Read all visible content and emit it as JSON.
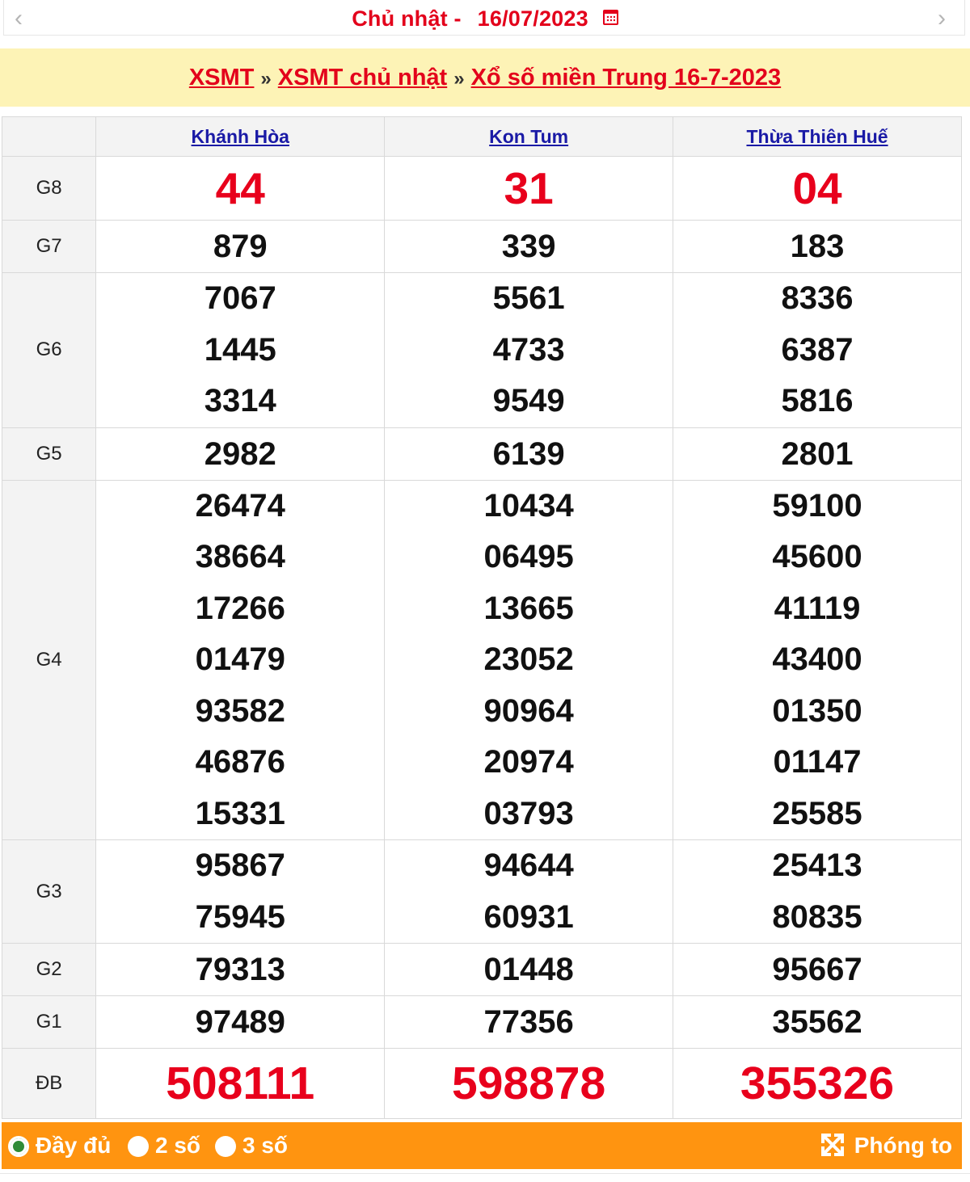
{
  "datebar": {
    "prev_icon": "chevron-left-icon",
    "day": "Chủ nhật -",
    "date": "16/07/2023",
    "calendar_icon": "calendar-icon",
    "next_icon": "chevron-right-icon"
  },
  "breadcrumb": {
    "items": [
      "XSMT",
      "XSMT chủ nhật",
      "Xổ số miền Trung 16-7-2023"
    ],
    "separator": "»"
  },
  "table": {
    "provinces": [
      "Khánh Hòa",
      "Kon Tum",
      "Thừa Thiên Huế"
    ],
    "prizes": [
      {
        "label": "G8",
        "values": [
          [
            "44"
          ],
          [
            "31"
          ],
          [
            "04"
          ]
        ]
      },
      {
        "label": "G7",
        "values": [
          [
            "879"
          ],
          [
            "339"
          ],
          [
            "183"
          ]
        ]
      },
      {
        "label": "G6",
        "values": [
          [
            "7067",
            "1445",
            "3314"
          ],
          [
            "5561",
            "4733",
            "9549"
          ],
          [
            "8336",
            "6387",
            "5816"
          ]
        ]
      },
      {
        "label": "G5",
        "values": [
          [
            "2982"
          ],
          [
            "6139"
          ],
          [
            "2801"
          ]
        ]
      },
      {
        "label": "G4",
        "values": [
          [
            "26474",
            "38664",
            "17266",
            "01479",
            "93582",
            "46876",
            "15331"
          ],
          [
            "10434",
            "06495",
            "13665",
            "23052",
            "90964",
            "20974",
            "03793"
          ],
          [
            "59100",
            "45600",
            "41119",
            "43400",
            "01350",
            "01147",
            "25585"
          ]
        ]
      },
      {
        "label": "G3",
        "values": [
          [
            "95867",
            "75945"
          ],
          [
            "94644",
            "60931"
          ],
          [
            "25413",
            "80835"
          ]
        ]
      },
      {
        "label": "G2",
        "values": [
          [
            "79313"
          ],
          [
            "01448"
          ],
          [
            "95667"
          ]
        ]
      },
      {
        "label": "G1",
        "values": [
          [
            "97489"
          ],
          [
            "77356"
          ],
          [
            "35562"
          ]
        ]
      },
      {
        "label": "ĐB",
        "values": [
          [
            "508111"
          ],
          [
            "598878"
          ],
          [
            "355326"
          ]
        ]
      }
    ]
  },
  "options": {
    "full": "Đầy đủ",
    "two": "2 số",
    "three": "3 số",
    "selected": "full",
    "zoom_label": "Phóng to",
    "zoom_icon": "expand-icon"
  },
  "colors": {
    "accent_red": "#e3001b",
    "header_yellow": "#fdf3b6",
    "option_orange": "#ff9410",
    "link_blue": "#1a1aa6"
  }
}
